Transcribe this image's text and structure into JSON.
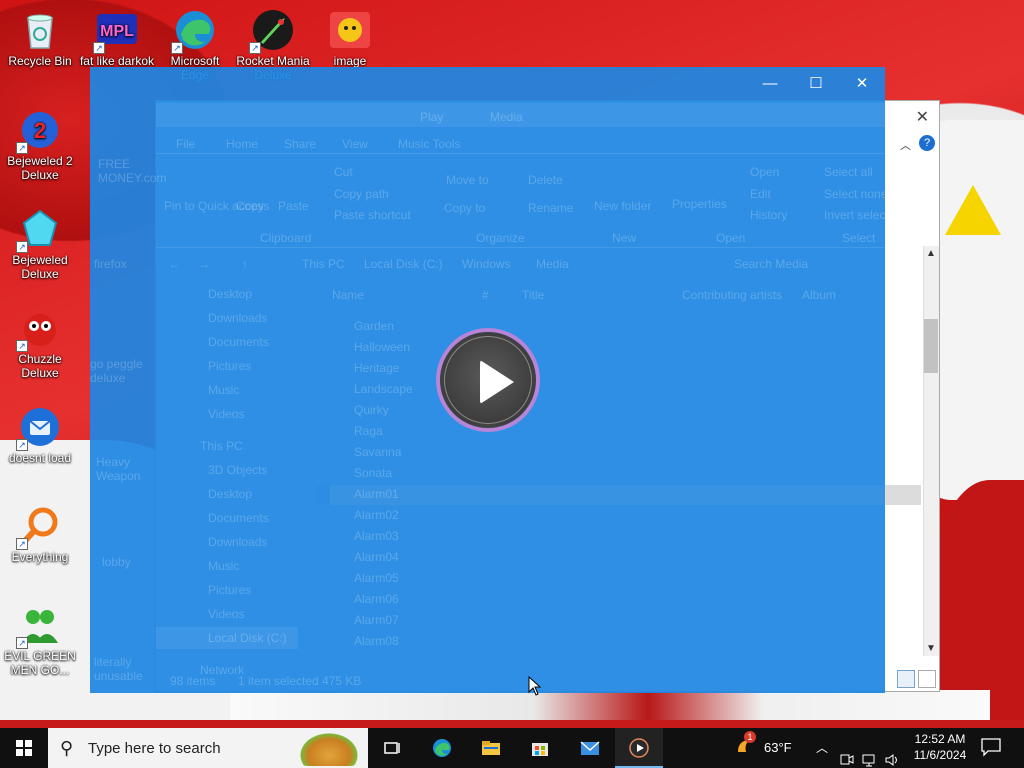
{
  "desktop": {
    "icons": [
      {
        "label": "Recycle Bin",
        "icon": "recycle-bin-icon"
      },
      {
        "label": "fat like darkok",
        "icon": "mpl-icon"
      },
      {
        "label": "Microsoft Edge",
        "icon": "edge-icon"
      },
      {
        "label": "Rocket Mania Deluxe",
        "icon": "rocket-icon"
      },
      {
        "label": "image",
        "icon": "image-icon"
      },
      {
        "label": "Bejeweled 2 Deluxe",
        "icon": "bejeweled2-icon"
      },
      {
        "label": "Bejeweled Deluxe",
        "icon": "bejeweled-icon"
      },
      {
        "label": "Chuzzle Deluxe",
        "icon": "chuzzle-icon"
      },
      {
        "label": "doesnt load",
        "icon": "thunderbird-icon"
      },
      {
        "label": "Everything",
        "icon": "everything-icon"
      },
      {
        "label": "EVIL GREEN MEN GO...",
        "icon": "green-men-icon"
      }
    ],
    "ghost_icons": [
      "FREE MONEY.com",
      "firefox",
      "go peggle deluxe",
      "Heavy Weapon",
      "lobby",
      "literally unusable"
    ]
  },
  "explorer_ghost": {
    "tabs": [
      "File",
      "Home",
      "Share",
      "View",
      "Music Tools"
    ],
    "context_tab": "Play",
    "window_title": "Media",
    "ribbon": {
      "clipboard": [
        "Pin to Quick access",
        "Copy",
        "Paste",
        "Cut",
        "Copy path",
        "Paste shortcut"
      ],
      "organize": [
        "Move to",
        "Copy to",
        "Delete",
        "Rename"
      ],
      "new": [
        "New folder"
      ],
      "open": [
        "Properties",
        "Open",
        "Edit",
        "History"
      ],
      "select": [
        "Select all",
        "Select none",
        "Invert selection"
      ],
      "groups": [
        "Clipboard",
        "Organize",
        "New",
        "Open",
        "Select"
      ]
    },
    "breadcrumb": [
      "This PC",
      "Local Disk (C:)",
      "Windows",
      "Media"
    ],
    "search_placeholder": "Search Media",
    "columns": [
      "Name",
      "#",
      "Title",
      "Contributing artists",
      "Album"
    ],
    "nav": [
      "Desktop",
      "Downloads",
      "Documents",
      "Pictures",
      "Music",
      "Videos",
      "This PC",
      "3D Objects",
      "Desktop",
      "Documents",
      "Downloads",
      "Music",
      "Pictures",
      "Videos",
      "Local Disk (C:)",
      "Network"
    ],
    "files": [
      "Garden",
      "Halloween",
      "Heritage",
      "Landscape",
      "Quirky",
      "Raga",
      "Savanna",
      "Sonata",
      "Alarm01",
      "Alarm02",
      "Alarm03",
      "Alarm04",
      "Alarm05",
      "Alarm06",
      "Alarm07",
      "Alarm08"
    ],
    "status": {
      "items": "98 items",
      "selected": "1 item selected  475 KB"
    }
  },
  "overlay": {
    "controls": {
      "minimize": "—",
      "maximize": "☐",
      "close": "✕"
    },
    "play_icon": "play-icon"
  },
  "taskbar": {
    "search_placeholder": "Type here to search",
    "apps": [
      "task-view-icon",
      "edge-icon",
      "file-explorer-icon",
      "store-icon",
      "mail-icon",
      "media-player-icon"
    ],
    "weather": {
      "temp": "63°F",
      "badge": "1"
    },
    "clock": {
      "time": "12:52 AM",
      "date": "11/6/2024"
    }
  }
}
